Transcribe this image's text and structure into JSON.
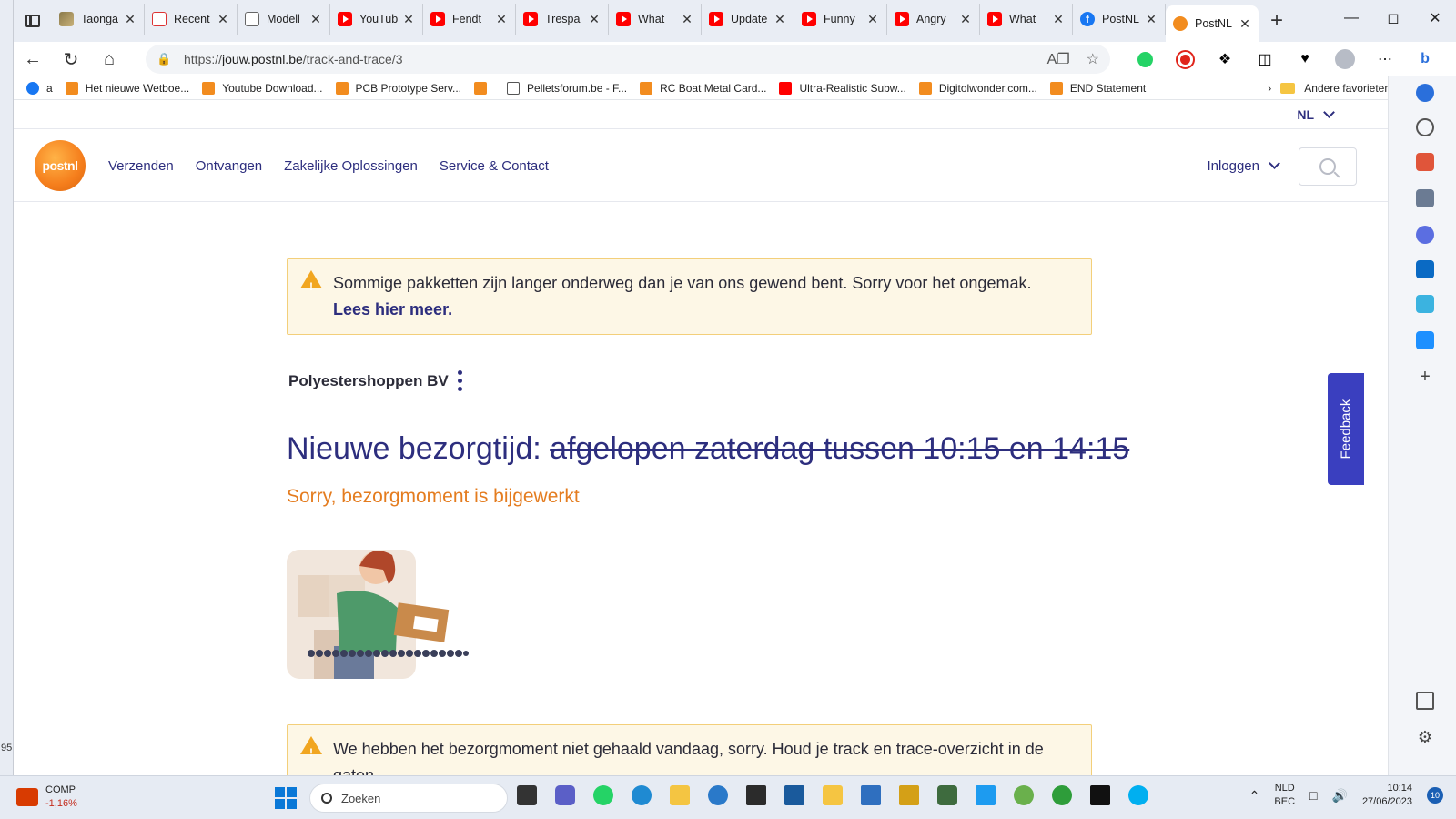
{
  "browser": {
    "tabs": [
      {
        "title": "Taonga",
        "icon": "image-favicon-icon"
      },
      {
        "title": "Recent",
        "icon": "site-favicon-icon"
      },
      {
        "title": "Modell",
        "icon": "github-favicon-icon"
      },
      {
        "title": "YouTub",
        "icon": "youtube-icon"
      },
      {
        "title": "Fendt",
        "icon": "youtube-icon"
      },
      {
        "title": "Trespa",
        "icon": "youtube-icon"
      },
      {
        "title": "What",
        "icon": "youtube-icon"
      },
      {
        "title": "Update",
        "icon": "youtube-icon"
      },
      {
        "title": "Funny",
        "icon": "youtube-icon"
      },
      {
        "title": "Angry",
        "icon": "youtube-icon"
      },
      {
        "title": "What",
        "icon": "youtube-icon"
      },
      {
        "title": "PostNL",
        "icon": "facebook-icon"
      },
      {
        "title": "PostNL",
        "icon": "postnl-favicon-icon",
        "active": true
      }
    ],
    "url_prefix": "https://",
    "url_host": "jouw.postnl.be",
    "url_path": "/track-and-trace/3",
    "bookmarks": [
      {
        "label": "a",
        "icon": "facebook-icon"
      },
      {
        "label": "Het nieuwe Wetboe...",
        "icon": "bookmark-icon"
      },
      {
        "label": "Youtube Download...",
        "icon": "bookmark-icon"
      },
      {
        "label": "PCB Prototype Serv...",
        "icon": "bookmark-icon"
      },
      {
        "label": "",
        "icon": "bookmark-icon"
      },
      {
        "label": "Pelletsforum.be - F...",
        "icon": "page-icon"
      },
      {
        "label": "RC Boat Metal Card...",
        "icon": "bookmark-icon"
      },
      {
        "label": "Ultra-Realistic Subw...",
        "icon": "youtube-icon"
      },
      {
        "label": "Digitolwonder.com...",
        "icon": "bookmark-icon"
      },
      {
        "label": "END Statement",
        "icon": "bookmark-icon"
      }
    ],
    "other_favorites": "Andere favorieten"
  },
  "page": {
    "language": "NL",
    "logo_text": "postnl",
    "nav": [
      "Verzenden",
      "Ontvangen",
      "Zakelijke Oplossingen",
      "Service & Contact"
    ],
    "login": "Inloggen",
    "alert_top": {
      "text": "Sommige pakketten zijn langer onderweg dan je van ons gewend bent. Sorry voor het ongemak.",
      "link": "Lees hier meer."
    },
    "sender": "Polyestershoppen BV",
    "delivery_label": "Nieuwe bezorgtijd:",
    "delivery_struck": "afgelopen zaterdag tussen 10:15 en 14:15",
    "status": "Sorry, bezorgmoment is bijgewerkt",
    "alert_bottom": {
      "text": "We hebben het bezorgmoment niet gehaald vandaag, sorry. Houd je track en trace-overzicht in de gaten."
    },
    "feedback": "Feedback"
  },
  "taskbar": {
    "stock_name": "COMP",
    "stock_change": "-1,16%",
    "search_placeholder": "Zoeken",
    "lang_top": "NLD",
    "lang_bottom": "BEC",
    "time": "10:14",
    "date": "27/06/2023",
    "notifications": "10"
  },
  "left_window": {
    "label": "95"
  },
  "colors": {
    "brand_orange": "#f57e1c",
    "brand_blue": "#2d2e7e",
    "alert_bg": "#fdf7e6",
    "alert_border": "#f3cf7a"
  }
}
